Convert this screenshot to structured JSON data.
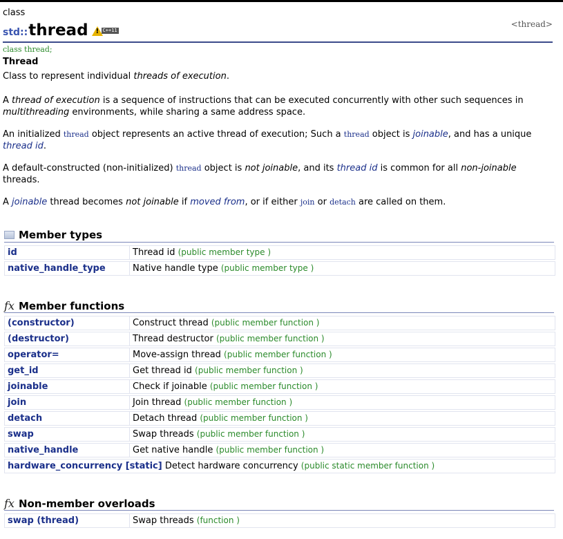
{
  "header": {
    "class_label": "class",
    "namespace": "std::",
    "title": "thread",
    "badge": "C++11",
    "header_file": "<thread>",
    "declaration": "class thread;",
    "subtitle": "Thread"
  },
  "intro": "Class to represent individual threads of execution.",
  "paragraphs": [
    {
      "spans": [
        {
          "t": "A "
        },
        {
          "t": "thread of execution",
          "s": "it"
        },
        {
          "t": " is a sequence of instructions that can be executed concurrently with other such sequences in "
        },
        {
          "t": "multithreading",
          "s": "it"
        },
        {
          "t": " environments, while sharing a same address space."
        }
      ]
    },
    {
      "spans": [
        {
          "t": "An initialized "
        },
        {
          "t": "thread",
          "s": "code"
        },
        {
          "t": " object represents an active thread of execution; Such a "
        },
        {
          "t": "thread",
          "s": "code"
        },
        {
          "t": " object is "
        },
        {
          "t": "joinable",
          "s": "link"
        },
        {
          "t": ", and has a unique "
        },
        {
          "t": "thread id",
          "s": "link"
        },
        {
          "t": "."
        }
      ]
    },
    {
      "spans": [
        {
          "t": "A default-constructed (non-initialized) "
        },
        {
          "t": "thread",
          "s": "code"
        },
        {
          "t": " object is "
        },
        {
          "t": "not joinable",
          "s": "it"
        },
        {
          "t": ", and its "
        },
        {
          "t": "thread id",
          "s": "link"
        },
        {
          "t": " is common for all "
        },
        {
          "t": "non-joinable",
          "s": "it"
        },
        {
          "t": " threads."
        }
      ]
    },
    {
      "spans": [
        {
          "t": "A "
        },
        {
          "t": "joinable",
          "s": "link"
        },
        {
          "t": " thread becomes "
        },
        {
          "t": "not joinable",
          "s": "it"
        },
        {
          "t": " if "
        },
        {
          "t": "moved from",
          "s": "link"
        },
        {
          "t": ", or if either "
        },
        {
          "t": "join",
          "s": "code"
        },
        {
          "t": " or "
        },
        {
          "t": "detach",
          "s": "code"
        },
        {
          "t": " are called on them."
        }
      ]
    }
  ],
  "member_types": {
    "heading": "Member types",
    "rows": [
      {
        "name": "id",
        "desc": "Thread id",
        "kind": "(public member type )"
      },
      {
        "name": "native_handle_type",
        "desc": "Native handle type",
        "kind": "(public member type )"
      }
    ]
  },
  "member_functions": {
    "heading": "Member functions",
    "rows": [
      {
        "name": "(constructor)",
        "desc": "Construct thread",
        "kind": "(public member function )"
      },
      {
        "name": "(destructor)",
        "desc": "Thread destructor",
        "kind": "(public member function )"
      },
      {
        "name": "operator=",
        "desc": "Move-assign thread",
        "kind": "(public member function )"
      },
      {
        "name": "get_id",
        "desc": "Get thread id",
        "kind": "(public member function )"
      },
      {
        "name": "joinable",
        "desc": "Check if joinable",
        "kind": "(public member function )"
      },
      {
        "name": "join",
        "desc": "Join thread",
        "kind": "(public member function )"
      },
      {
        "name": "detach",
        "desc": "Detach thread",
        "kind": "(public member function )"
      },
      {
        "name": "swap",
        "desc": "Swap threads",
        "kind": "(public member function )"
      },
      {
        "name": "native_handle",
        "desc": "Get native handle",
        "kind": "(public member function )"
      },
      {
        "name": "hardware_concurrency [static]",
        "desc": "Detect hardware concurrency",
        "kind": "(public static member function )",
        "wide": true
      }
    ]
  },
  "non_member": {
    "heading": "Non-member overloads",
    "rows": [
      {
        "name": "swap (thread)",
        "desc": "Swap threads",
        "kind": "(function )"
      }
    ]
  },
  "icons": {
    "member_types": "book-icon",
    "functions": "fx-icon",
    "badge": "warning-icon"
  },
  "colors": {
    "link": "#1a2f8a",
    "kind": "#2a8a2a",
    "rule": "#3b4a8a"
  }
}
